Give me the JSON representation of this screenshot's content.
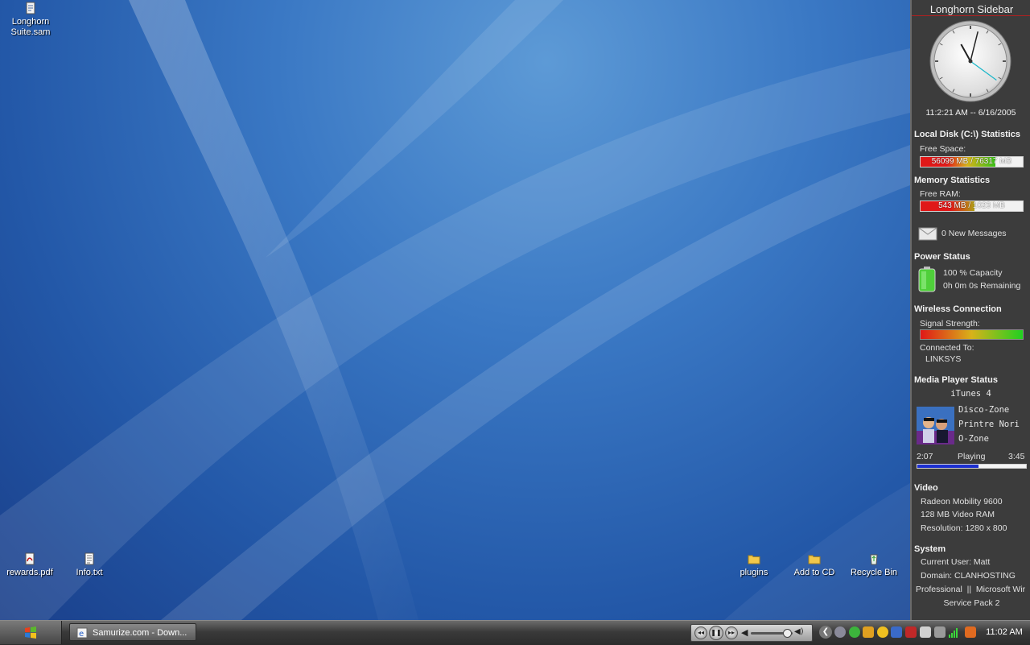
{
  "desktop": {
    "icons": [
      {
        "label": "Longhorn\nSuite.sam",
        "icon": "document-icon"
      },
      {
        "label": "rewards.pdf",
        "icon": "pdf-icon"
      },
      {
        "label": "Info.txt",
        "icon": "text-file-icon"
      },
      {
        "label": "plugins",
        "icon": "folder-icon"
      },
      {
        "label": "Add to CD",
        "icon": "folder-icon"
      },
      {
        "label": "Recycle Bin",
        "icon": "recycle-bin-icon"
      }
    ]
  },
  "sidebar": {
    "title": "Longhorn Sidebar",
    "clock": {
      "datetime": "11:2:21 AM -- 6/16/2005",
      "hour": 11,
      "minute": 2,
      "second": 21
    },
    "disk": {
      "heading": "Local Disk (C:\\) Statistics",
      "label": "Free Space:",
      "value": "56099 MB / 76317 MB",
      "fraction": 0.735
    },
    "memory": {
      "heading": "Memory Statistics",
      "label": "Free RAM:",
      "value": "543 MB / 1023 MB",
      "fraction": 0.53
    },
    "mail": {
      "text": "0 New Messages",
      "icon": "envelope-icon"
    },
    "power": {
      "heading": "Power Status",
      "capacity": "100 % Capacity",
      "remaining": "0h 0m 0s Remaining",
      "icon": "battery-icon"
    },
    "wireless": {
      "heading": "Wireless Connection",
      "signal_label": "Signal Strength:",
      "signal_fraction": 1.0,
      "connected_label": "Connected To:",
      "ssid": "LINKSYS"
    },
    "media": {
      "heading": "Media Player Status",
      "player": "iTunes 4",
      "track": "Disco-Zone",
      "album": "Printre Nori",
      "artist": "O-Zone",
      "elapsed": "2:07",
      "state": "Playing",
      "duration": "3:45",
      "progress": 0.56,
      "icon": "album-art-icon"
    },
    "video": {
      "heading": "Video",
      "card": "Radeon Mobility 9600",
      "vram": "128 MB Video RAM",
      "resolution": "Resolution:  1280 x 800"
    },
    "system": {
      "heading": "System",
      "user": "Current User: Matt",
      "domain": "Domain: CLANHOSTING",
      "os": "Professional  ||  Microsoft Wir",
      "sp": "Service Pack 2"
    }
  },
  "taskbar": {
    "start_icon": "windows-logo-icon",
    "task_button": "Samurize.com - Down...",
    "time": "11:02 AM",
    "colors": {
      "accent": "#3c3c3c"
    }
  }
}
